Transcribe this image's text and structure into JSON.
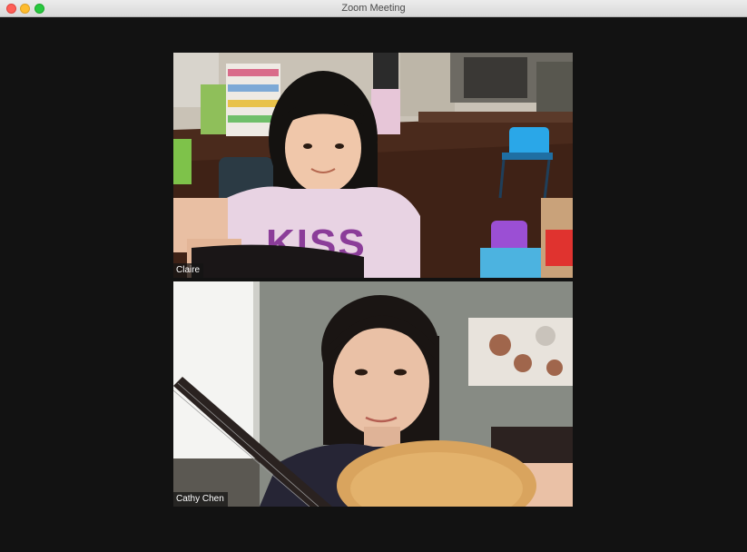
{
  "window": {
    "title": "Zoom Meeting"
  },
  "participants": [
    {
      "name": "Claire",
      "shirt_text": "KISS"
    },
    {
      "name": "Cathy Chen"
    }
  ]
}
